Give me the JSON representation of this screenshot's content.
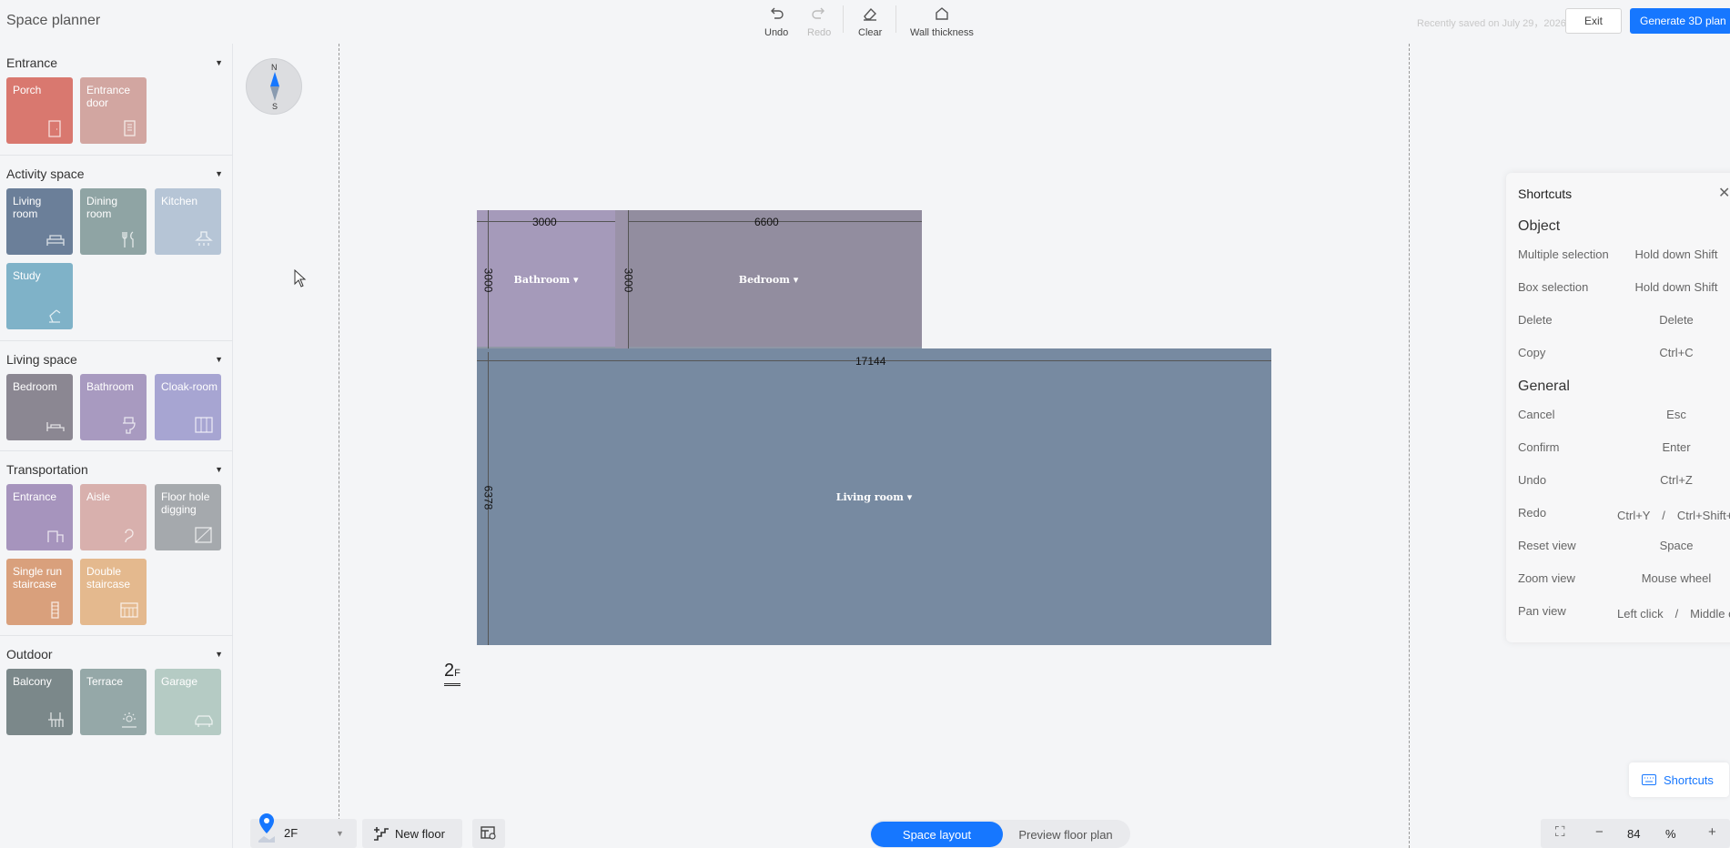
{
  "app": {
    "title": "Space planner"
  },
  "toolbar": {
    "undo": "Undo",
    "redo": "Redo",
    "clear": "Clear",
    "wall_thickness": "Wall thickness",
    "save_status": "Recently saved on July 29，2026",
    "exit": "Exit",
    "generate": "Generate 3D plan"
  },
  "sidebar": {
    "sections": [
      {
        "title": "Entrance",
        "tiles": [
          {
            "label": "Porch",
            "color": "#d9786f",
            "icon": "door-icon"
          },
          {
            "label": "Entrance door",
            "color": "#d2a6a1",
            "icon": "keypad-door-icon"
          }
        ]
      },
      {
        "title": "Activity space",
        "tiles": [
          {
            "label": "Living room",
            "color": "#6b7f99",
            "icon": "sofa-icon"
          },
          {
            "label": "Dining room",
            "color": "#8fa4a4",
            "icon": "cutlery-icon"
          },
          {
            "label": "Kitchen",
            "color": "#b6c5d6",
            "icon": "range-hood-icon"
          },
          {
            "label": "Study",
            "color": "#7fb2c8",
            "icon": "desk-lamp-icon"
          }
        ]
      },
      {
        "title": "Living space",
        "tiles": [
          {
            "label": "Bedroom",
            "color": "#8b8792",
            "icon": "bed-icon"
          },
          {
            "label": "Bathroom",
            "color": "#a89ac0",
            "icon": "toilet-icon"
          },
          {
            "label": "Cloak-room",
            "color": "#a7a5d2",
            "icon": "wardrobe-icon"
          }
        ]
      },
      {
        "title": "Transportation",
        "tiles": [
          {
            "label": "Entrance",
            "color": "#a694bd",
            "icon": "entrance-icon"
          },
          {
            "label": "Aisle",
            "color": "#d8b0ad",
            "icon": "aisle-icon"
          },
          {
            "label": "Floor hole digging",
            "color": "#a5a9ad",
            "icon": "floor-hole-icon"
          },
          {
            "label": "Single run staircase",
            "color": "#d9a07c",
            "icon": "single-stair-icon"
          },
          {
            "label": "Double staircase",
            "color": "#e4b98e",
            "icon": "double-stair-icon"
          }
        ]
      },
      {
        "title": "Outdoor",
        "tiles": [
          {
            "label": "Balcony",
            "color": "#7b888a",
            "icon": "balcony-icon"
          },
          {
            "label": "Terrace",
            "color": "#95a8a8",
            "icon": "terrace-icon"
          },
          {
            "label": "Garage",
            "color": "#b5cbc4",
            "icon": "car-icon"
          }
        ]
      }
    ]
  },
  "plan": {
    "rooms": [
      {
        "label": "Bathroom ▾",
        "color": "#a59aba"
      },
      {
        "label": "Bedroom ▾",
        "color": "#928d9f"
      },
      {
        "label": "Living room ▾",
        "color": "#778aa1"
      }
    ],
    "dimensions": {
      "bath_width": "3000",
      "bed_width": "6600",
      "bath_height": "3000",
      "bed_height": "3000",
      "living_width": "17144",
      "living_height": "6378"
    },
    "floor_label": "2",
    "floor_suffix": "F"
  },
  "shortcuts": {
    "title": "Shortcuts",
    "groups": [
      {
        "title": "Object",
        "rows": [
          {
            "k": "Multiple selection",
            "v": "Hold down Shift"
          },
          {
            "k": "Box selection",
            "v": "Hold down Shift"
          },
          {
            "k": "Delete",
            "v": "Delete"
          },
          {
            "k": "Copy",
            "v": "Ctrl+C"
          }
        ]
      },
      {
        "title": "General",
        "rows": [
          {
            "k": "Cancel",
            "v": "Esc"
          },
          {
            "k": "Confirm",
            "v": "Enter"
          },
          {
            "k": "Undo",
            "v": "Ctrl+Z"
          },
          {
            "k": "Redo",
            "v": "Ctrl+Y　/　Ctrl+Shift+Z"
          },
          {
            "k": "Reset view",
            "v": "Space"
          },
          {
            "k": "Zoom view",
            "v": "Mouse wheel"
          },
          {
            "k": "Pan view",
            "v": "Left click　/　Middle click"
          }
        ]
      }
    ],
    "button": "Shortcuts"
  },
  "bottom": {
    "floor": "2F",
    "new_floor": "New floor",
    "space_layout": "Space layout",
    "preview": "Preview floor plan",
    "zoom": "84",
    "zoom_unit": "%"
  }
}
